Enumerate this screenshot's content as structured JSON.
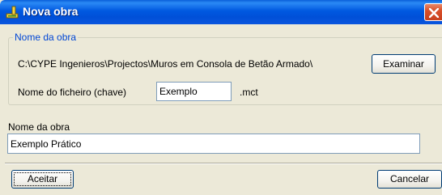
{
  "window": {
    "title": "Nova obra"
  },
  "group": {
    "legend": "Nome da obra",
    "path": "C:\\CYPE Ingenieros\\Projectos\\Muros em Consola de Betão Armado\\",
    "examinar_label": "Examinar",
    "file_label": "Nome do ficheiro (chave)",
    "file_value": "Exemplo",
    "extension": ".mct"
  },
  "name_field": {
    "label": "Nome da obra",
    "value": "Exemplo Prático"
  },
  "footer": {
    "accept_label": "Aceitar",
    "cancel_label": "Cancelar"
  },
  "colors": {
    "titlebar": "#0054e3",
    "close_button": "#d9502a",
    "group_legend": "#0046d5",
    "dialog_background": "#ece9d8"
  },
  "icons": {
    "app": "app-icon",
    "close": "close-icon"
  }
}
